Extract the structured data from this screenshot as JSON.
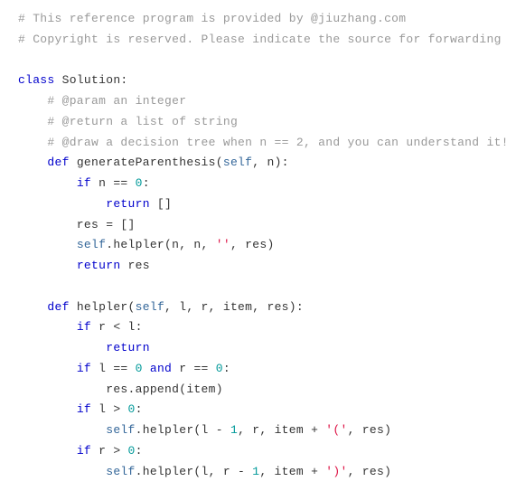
{
  "code_lines": [
    [
      {
        "t": "comment",
        "v": "# This reference program is provided by @jiuzhang.com"
      }
    ],
    [
      {
        "t": "comment",
        "v": "# Copyright is reserved. Please indicate the source for forwarding"
      }
    ],
    [
      {
        "t": "plain",
        "v": ""
      }
    ],
    [
      {
        "t": "keyword",
        "v": "class"
      },
      {
        "t": "plain",
        "v": " Solution:"
      }
    ],
    [
      {
        "t": "plain",
        "v": "    "
      },
      {
        "t": "comment",
        "v": "# @param an integer"
      }
    ],
    [
      {
        "t": "plain",
        "v": "    "
      },
      {
        "t": "comment",
        "v": "# @return a list of string"
      }
    ],
    [
      {
        "t": "plain",
        "v": "    "
      },
      {
        "t": "comment",
        "v": "# @draw a decision tree when n == 2, and you can understand it!"
      }
    ],
    [
      {
        "t": "plain",
        "v": "    "
      },
      {
        "t": "keyword",
        "v": "def"
      },
      {
        "t": "plain",
        "v": " generateParenthesis("
      },
      {
        "t": "builtin",
        "v": "self"
      },
      {
        "t": "plain",
        "v": ", n):"
      }
    ],
    [
      {
        "t": "plain",
        "v": "        "
      },
      {
        "t": "keyword",
        "v": "if"
      },
      {
        "t": "plain",
        "v": " n == "
      },
      {
        "t": "number",
        "v": "0"
      },
      {
        "t": "plain",
        "v": ":"
      }
    ],
    [
      {
        "t": "plain",
        "v": "            "
      },
      {
        "t": "keyword",
        "v": "return"
      },
      {
        "t": "plain",
        "v": " []"
      }
    ],
    [
      {
        "t": "plain",
        "v": "        res = []"
      }
    ],
    [
      {
        "t": "plain",
        "v": "        "
      },
      {
        "t": "builtin",
        "v": "self"
      },
      {
        "t": "plain",
        "v": ".helpler(n, n, "
      },
      {
        "t": "string",
        "v": "''"
      },
      {
        "t": "plain",
        "v": ", res)"
      }
    ],
    [
      {
        "t": "plain",
        "v": "        "
      },
      {
        "t": "keyword",
        "v": "return"
      },
      {
        "t": "plain",
        "v": " res"
      }
    ],
    [
      {
        "t": "plain",
        "v": ""
      }
    ],
    [
      {
        "t": "plain",
        "v": "    "
      },
      {
        "t": "keyword",
        "v": "def"
      },
      {
        "t": "plain",
        "v": " helpler("
      },
      {
        "t": "builtin",
        "v": "self"
      },
      {
        "t": "plain",
        "v": ", l, r, item, res):"
      }
    ],
    [
      {
        "t": "plain",
        "v": "        "
      },
      {
        "t": "keyword",
        "v": "if"
      },
      {
        "t": "plain",
        "v": " r < l:"
      }
    ],
    [
      {
        "t": "plain",
        "v": "            "
      },
      {
        "t": "keyword",
        "v": "return"
      }
    ],
    [
      {
        "t": "plain",
        "v": "        "
      },
      {
        "t": "keyword",
        "v": "if"
      },
      {
        "t": "plain",
        "v": " l == "
      },
      {
        "t": "number",
        "v": "0"
      },
      {
        "t": "plain",
        "v": " "
      },
      {
        "t": "keyword",
        "v": "and"
      },
      {
        "t": "plain",
        "v": " r == "
      },
      {
        "t": "number",
        "v": "0"
      },
      {
        "t": "plain",
        "v": ":"
      }
    ],
    [
      {
        "t": "plain",
        "v": "            res.append(item)"
      }
    ],
    [
      {
        "t": "plain",
        "v": "        "
      },
      {
        "t": "keyword",
        "v": "if"
      },
      {
        "t": "plain",
        "v": " l > "
      },
      {
        "t": "number",
        "v": "0"
      },
      {
        "t": "plain",
        "v": ":"
      }
    ],
    [
      {
        "t": "plain",
        "v": "            "
      },
      {
        "t": "builtin",
        "v": "self"
      },
      {
        "t": "plain",
        "v": ".helpler(l - "
      },
      {
        "t": "number",
        "v": "1"
      },
      {
        "t": "plain",
        "v": ", r, item + "
      },
      {
        "t": "string",
        "v": "'('"
      },
      {
        "t": "plain",
        "v": ", res)"
      }
    ],
    [
      {
        "t": "plain",
        "v": "        "
      },
      {
        "t": "keyword",
        "v": "if"
      },
      {
        "t": "plain",
        "v": " r > "
      },
      {
        "t": "number",
        "v": "0"
      },
      {
        "t": "plain",
        "v": ":"
      }
    ],
    [
      {
        "t": "plain",
        "v": "            "
      },
      {
        "t": "builtin",
        "v": "self"
      },
      {
        "t": "plain",
        "v": ".helpler(l, r - "
      },
      {
        "t": "number",
        "v": "1"
      },
      {
        "t": "plain",
        "v": ", item + "
      },
      {
        "t": "string",
        "v": "')'"
      },
      {
        "t": "plain",
        "v": ", res)"
      }
    ]
  ]
}
